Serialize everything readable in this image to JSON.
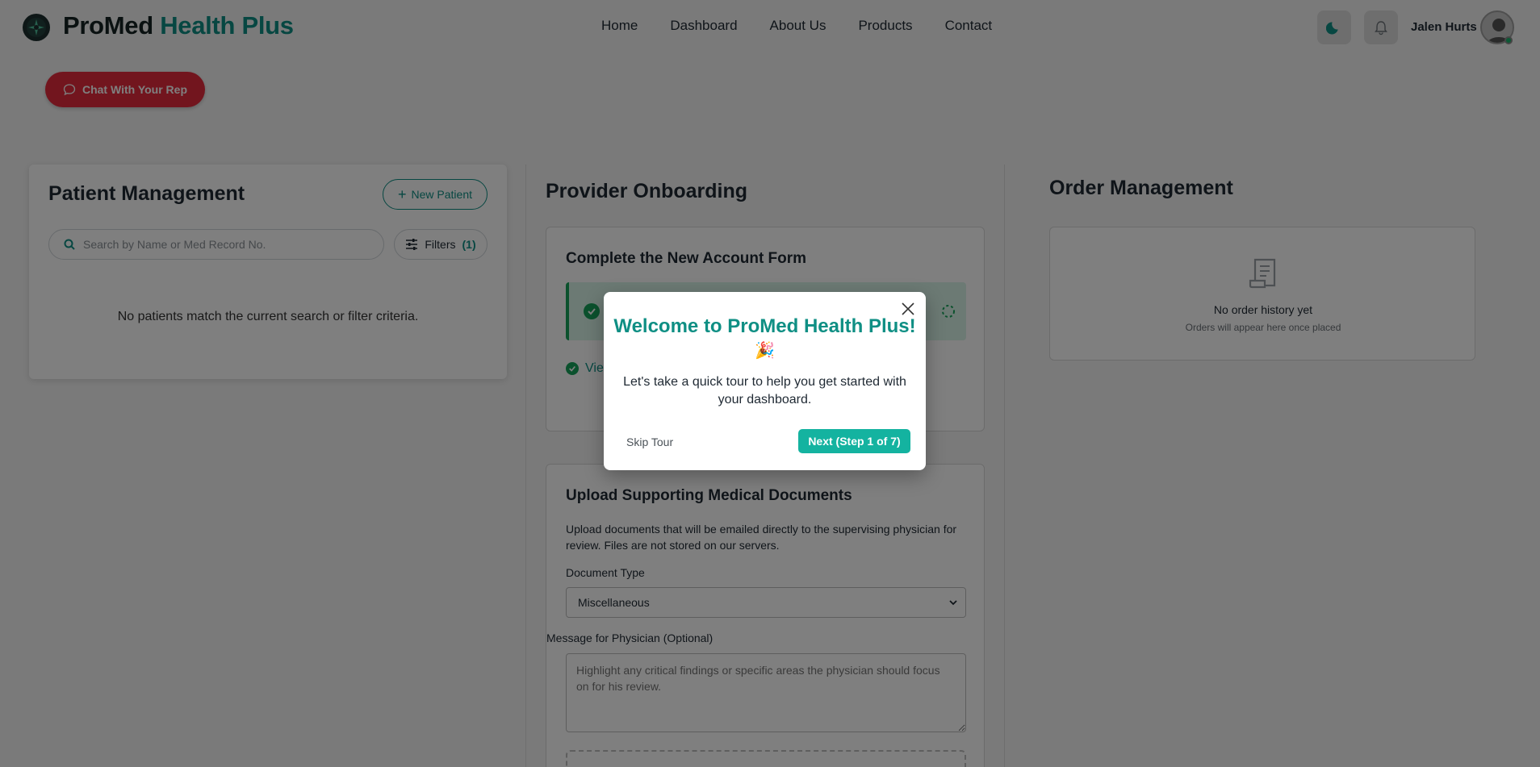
{
  "header": {
    "brand_part1": "ProMed",
    "brand_part2": "Health Plus",
    "nav": [
      "Home",
      "Dashboard",
      "About Us",
      "Products",
      "Contact"
    ],
    "user_name": "Jalen Hurts",
    "theme_icon": "moon-icon",
    "notification_icon": "bell-icon"
  },
  "chat_button": {
    "label": "Chat With Your Rep",
    "icon": "chat-bubble-icon"
  },
  "patient_management": {
    "title": "Patient Management",
    "new_patient_label": "New Patient",
    "search_placeholder": "Search by Name or Med Record No.",
    "filters_label": "Filters",
    "filters_count": "(1)",
    "empty_message": "No patients match the current search or filter criteria."
  },
  "provider_onboarding": {
    "title": "Provider Onboarding",
    "form_card_title": "Complete the New Account Form",
    "view_link_label": "Vie",
    "upload": {
      "title": "Upload Supporting Medical Documents",
      "description": "Upload documents that will be emailed directly to the supervising physician for review. Files are not stored on our servers.",
      "document_type_label": "Document Type",
      "document_type_value": "Miscellaneous",
      "message_label": "Message for Physician (Optional)",
      "message_placeholder": "Highlight any critical findings or specific areas the physician should focus on for his review."
    }
  },
  "order_management": {
    "title": "Order Management",
    "empty_title": "No order history yet",
    "empty_subtitle": "Orders will appear here once placed"
  },
  "tour_modal": {
    "title": "Welcome to ProMed Health Plus!",
    "emoji": "🎉",
    "body": "Let's take a quick tour to help you get started with your dashboard.",
    "skip_label": "Skip Tour",
    "next_label": "Next (Step 1 of 7)"
  },
  "colors": {
    "brand_teal": "#0f8f84",
    "chat_red": "#e52b3c",
    "next_button": "#14b3a0",
    "success_green": "#17a35a"
  }
}
